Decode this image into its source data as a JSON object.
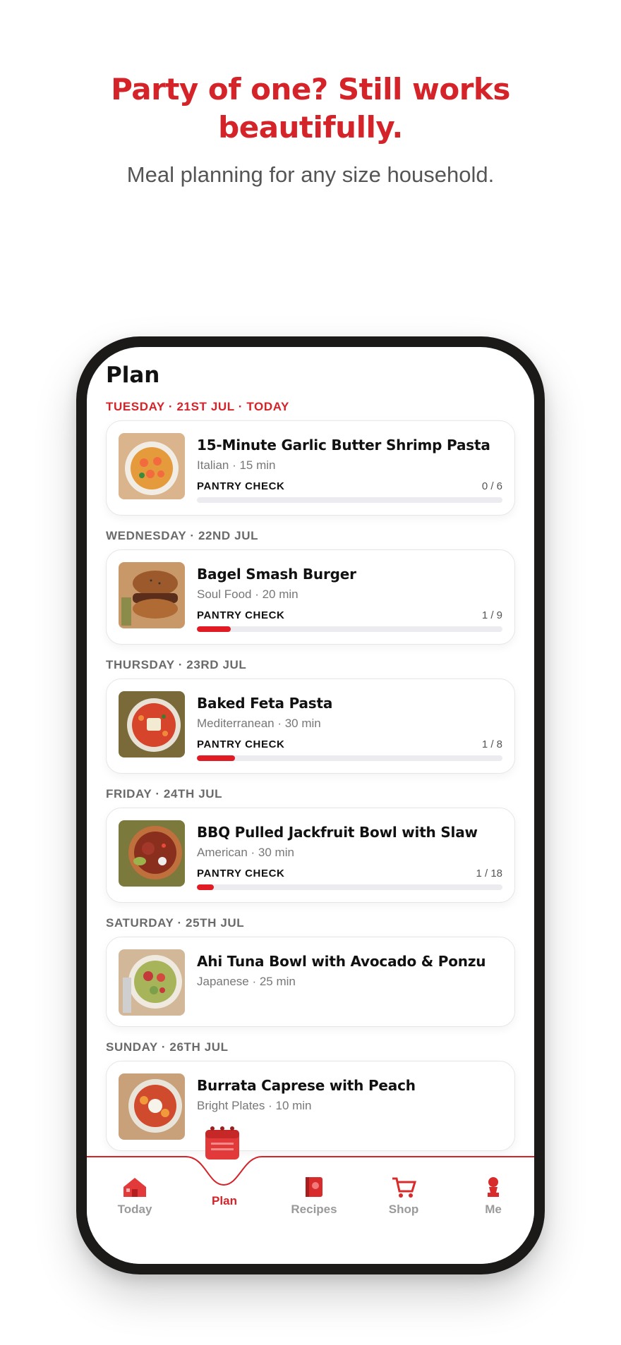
{
  "hero": {
    "headline": "Party of one? Still works beautifully.",
    "subheadline": "Meal planning for any size household."
  },
  "screen": {
    "title": "Plan",
    "pantry_label": "PANTRY CHECK",
    "days": [
      {
        "label": "TUESDAY · 21ST JUL · TODAY",
        "title": "15-Minute Garlic Butter Shrimp Pasta",
        "meta": "Italian · 15 min",
        "count": "0 / 6",
        "progress": 0.0
      },
      {
        "label": "WEDNESDAY · 22ND JUL",
        "title": "Bagel Smash Burger",
        "meta": "Soul Food · 20 min",
        "count": "1 / 9",
        "progress": 0.111
      },
      {
        "label": "THURSDAY · 23RD JUL",
        "title": "Baked Feta Pasta",
        "meta": "Mediterranean · 30 min",
        "count": "1 / 8",
        "progress": 0.125
      },
      {
        "label": "FRIDAY · 24TH JUL",
        "title": "BBQ Pulled Jackfruit Bowl with Slaw",
        "meta": "American · 30 min",
        "count": "1 / 18",
        "progress": 0.056
      },
      {
        "label": "SATURDAY · 25TH JUL",
        "title": "Ahi Tuna Bowl with Avocado & Ponzu",
        "meta": "Japanese · 25 min"
      },
      {
        "label": "SUNDAY · 26TH JUL",
        "title": "Burrata Caprese with Peach",
        "meta": "Bright Plates · 10 min"
      }
    ]
  },
  "tabs": [
    {
      "label": "Today",
      "icon": "house-icon"
    },
    {
      "label": "Plan",
      "icon": "calendar-icon"
    },
    {
      "label": "Recipes",
      "icon": "book-icon"
    },
    {
      "label": "Shop",
      "icon": "cart-icon"
    },
    {
      "label": "Me",
      "icon": "bust-icon"
    }
  ],
  "colors": {
    "accent": "#d5232a",
    "progress": "#e01b24",
    "phone_frame": "#1c1a19"
  }
}
